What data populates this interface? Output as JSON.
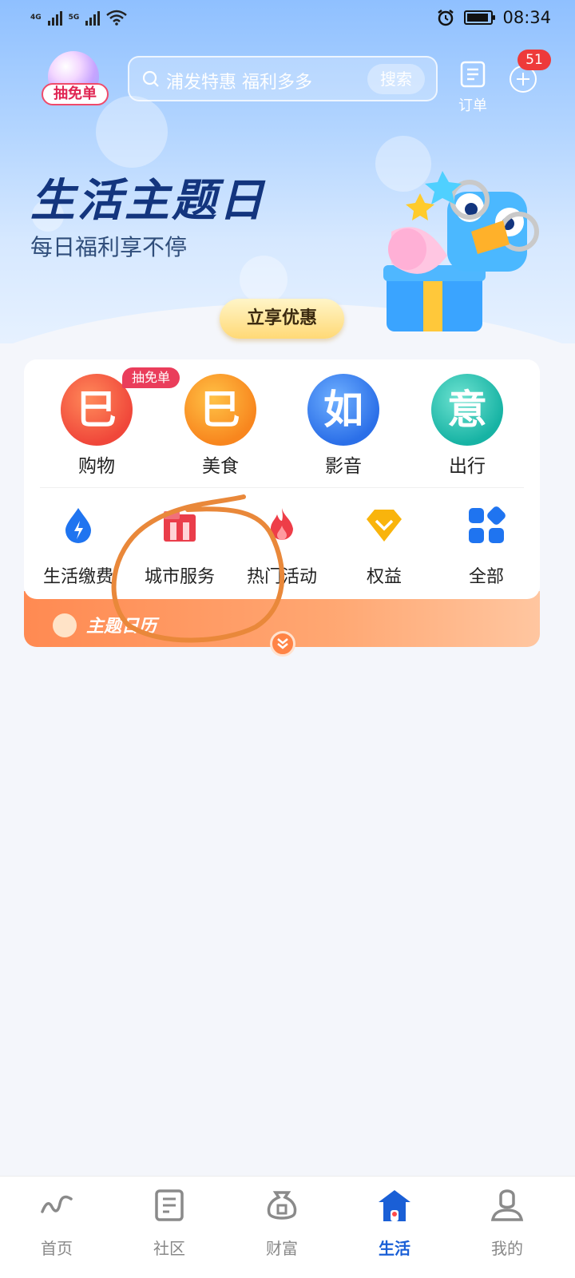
{
  "status_bar": {
    "time": "08:34",
    "network_1": "4G",
    "network_2": "5G"
  },
  "header": {
    "avatar_badge": "抽免单",
    "search_placeholder": "浦发特惠 福利多多",
    "search_button": "搜索",
    "order_label": "订单",
    "notification_count": "51"
  },
  "hero": {
    "title": "生活主题日",
    "subtitle": "每日福利享不停",
    "cta": "立享优惠"
  },
  "main_services": [
    {
      "label": "购物",
      "glyph": "巳",
      "tag": "抽免单",
      "icon": "shopping-bag-icon",
      "color": "#f0473a"
    },
    {
      "label": "美食",
      "glyph": "巳",
      "icon": "food-icon",
      "color": "#f8861e"
    },
    {
      "label": "影音",
      "glyph": "如",
      "icon": "media-play-icon",
      "color": "#2b6fe8"
    },
    {
      "label": "出行",
      "glyph": "意",
      "icon": "travel-icon",
      "color": "#17b3a4"
    }
  ],
  "quick_services": [
    {
      "label": "生活缴费",
      "icon": "water-drop-icon",
      "color": "#1f74f0"
    },
    {
      "label": "城市服务",
      "icon": "city-building-icon",
      "color": "#ea3d4a"
    },
    {
      "label": "热门活动",
      "icon": "flame-icon",
      "color": "#ee3d48"
    },
    {
      "label": "权益",
      "icon": "diamond-icon",
      "color": "#f9b40c"
    },
    {
      "label": "全部",
      "icon": "grid-all-icon",
      "color": "#1f74f0"
    }
  ],
  "calendar": {
    "label": "主题日历"
  },
  "bottom_nav": [
    {
      "label": "首页",
      "icon": "home-wave-icon",
      "active": false
    },
    {
      "label": "社区",
      "icon": "community-icon",
      "active": false
    },
    {
      "label": "财富",
      "icon": "wealth-bag-icon",
      "active": false
    },
    {
      "label": "生活",
      "icon": "house-icon",
      "active": true
    },
    {
      "label": "我的",
      "icon": "profile-icon",
      "active": false
    }
  ],
  "colors": {
    "accent_blue": "#1a5fd6",
    "badge_red": "#ee3a3a",
    "calendar_orange": "#ff8a52",
    "annotation_orange": "#e9883a"
  }
}
